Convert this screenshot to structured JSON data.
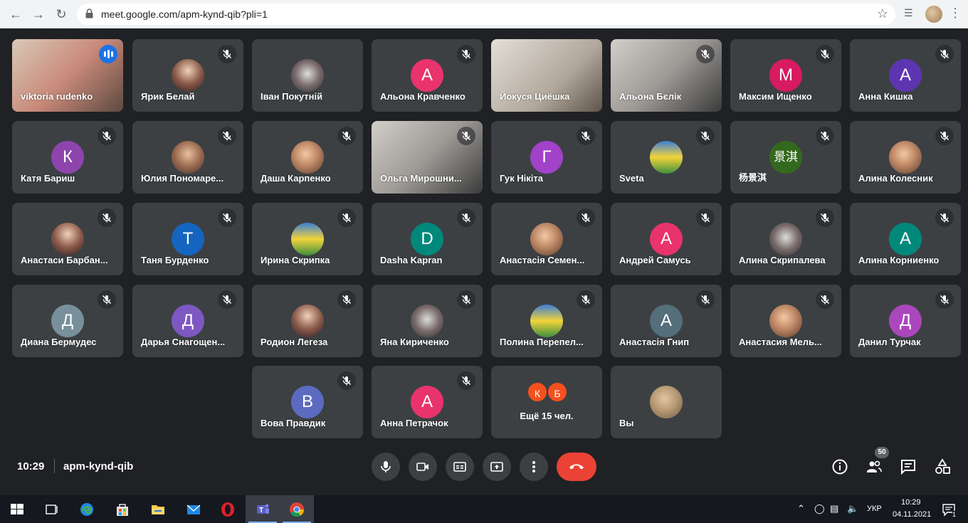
{
  "browser": {
    "url": "meet.google.com/apm-kynd-qib?pli=1"
  },
  "tiles": [
    {
      "name": "viktoria rudenko",
      "type": "video",
      "speaking": true,
      "muted": false
    },
    {
      "name": "Ярик Белай",
      "type": "photo",
      "muted": true
    },
    {
      "name": "Іван Покутній",
      "type": "photo",
      "muted": false
    },
    {
      "name": "Альона Кравченко",
      "type": "letter",
      "letter": "А",
      "color": "#e8336d",
      "muted": true
    },
    {
      "name": "Йокуся Циёшка",
      "type": "video",
      "muted": false
    },
    {
      "name": "Альона Бєлік",
      "type": "video",
      "muted": true
    },
    {
      "name": "Максим Ищенко",
      "type": "letter",
      "letter": "М",
      "color": "#d81b60",
      "muted": true
    },
    {
      "name": "Анна Кишка",
      "type": "letter",
      "letter": "А",
      "color": "#5e35b1",
      "muted": true
    },
    {
      "name": "Катя Бариш",
      "type": "letter",
      "letter": "К",
      "color": "#8e44ad",
      "muted": true
    },
    {
      "name": "Юлия Пономаренко",
      "display": "Юлия Пономаре...",
      "type": "photo",
      "muted": true
    },
    {
      "name": "Даша Карпенко",
      "type": "photo",
      "muted": true
    },
    {
      "name": "Ольга Мирошниченко",
      "display": "Ольга Мирошни...",
      "type": "video",
      "muted": true
    },
    {
      "name": "Гук Нікіта",
      "type": "letter",
      "letter": "Г",
      "color": "#a142c9",
      "muted": true
    },
    {
      "name": "Sveta",
      "type": "photo",
      "muted": true
    },
    {
      "name": "杨景淇",
      "type": "letter",
      "letter": "景淇",
      "color": "#33691e",
      "muted": true
    },
    {
      "name": "Алина Колесник",
      "type": "photo",
      "muted": true
    },
    {
      "name": "Анастаси Барбанова",
      "display": "Анастаси Барбан...",
      "type": "photo",
      "muted": true
    },
    {
      "name": "Таня Бурденко",
      "type": "letter",
      "letter": "Т",
      "color": "#1565c0",
      "muted": true
    },
    {
      "name": "Ирина Скрипка",
      "type": "photo",
      "muted": true
    },
    {
      "name": "Dasha Kapran",
      "type": "letter",
      "letter": "D",
      "color": "#00897b",
      "muted": true
    },
    {
      "name": "Анастасія Семенко",
      "display": "Анастасія Семен...",
      "type": "photo",
      "muted": true
    },
    {
      "name": "Андрей Самусь",
      "type": "letter",
      "letter": "А",
      "color": "#e8336d",
      "muted": true
    },
    {
      "name": "Алина Скрипалева",
      "type": "photo",
      "muted": true
    },
    {
      "name": "Алина Корниенко",
      "type": "letter",
      "letter": "А",
      "color": "#00897b",
      "muted": true
    },
    {
      "name": "Диана Бермудес",
      "type": "letter",
      "letter": "Д",
      "color": "#78909c",
      "muted": true
    },
    {
      "name": "Дарья Снагощенко",
      "display": "Дарья Снагощен...",
      "type": "letter",
      "letter": "Д",
      "color": "#7e57c2",
      "muted": true
    },
    {
      "name": "Родион Легеза",
      "type": "photo",
      "muted": true
    },
    {
      "name": "Яна Кириченко",
      "type": "photo",
      "muted": true
    },
    {
      "name": "Полина Перепелица",
      "display": "Полина Перепел...",
      "type": "photo",
      "muted": true
    },
    {
      "name": "Анастасія Гнип",
      "type": "letter",
      "letter": "А",
      "color": "#546e7a",
      "muted": true
    },
    {
      "name": "Анастасия Мельник",
      "display": "Анастасия Мель...",
      "type": "photo",
      "muted": true
    },
    {
      "name": "Данил Турчак",
      "type": "letter",
      "letter": "Д",
      "color": "#ab47bc",
      "muted": true
    },
    {
      "name": "Вова Правдик",
      "type": "letter",
      "letter": "В",
      "color": "#5c6bc0",
      "muted": true
    },
    {
      "name": "Анна Петрачок",
      "type": "letter",
      "letter": "А",
      "color": "#e8336d",
      "muted": true
    }
  ],
  "more": {
    "letters": [
      "К",
      "Б"
    ],
    "colors": [
      "#f4511e",
      "#f4511e"
    ],
    "label": "Ещё 15 чел."
  },
  "self": {
    "name": "Вы"
  },
  "meeting": {
    "time": "10:29",
    "code": "apm-kynd-qib",
    "participants_badge": "50"
  },
  "taskbar": {
    "lang": "УКР",
    "time": "10:29",
    "date": "04.11.2021",
    "notifications": "1"
  },
  "colors": {
    "background": "#202124",
    "tile": "#3c4043",
    "hangup": "#ea4335",
    "speaking": "#8ab4f8"
  }
}
